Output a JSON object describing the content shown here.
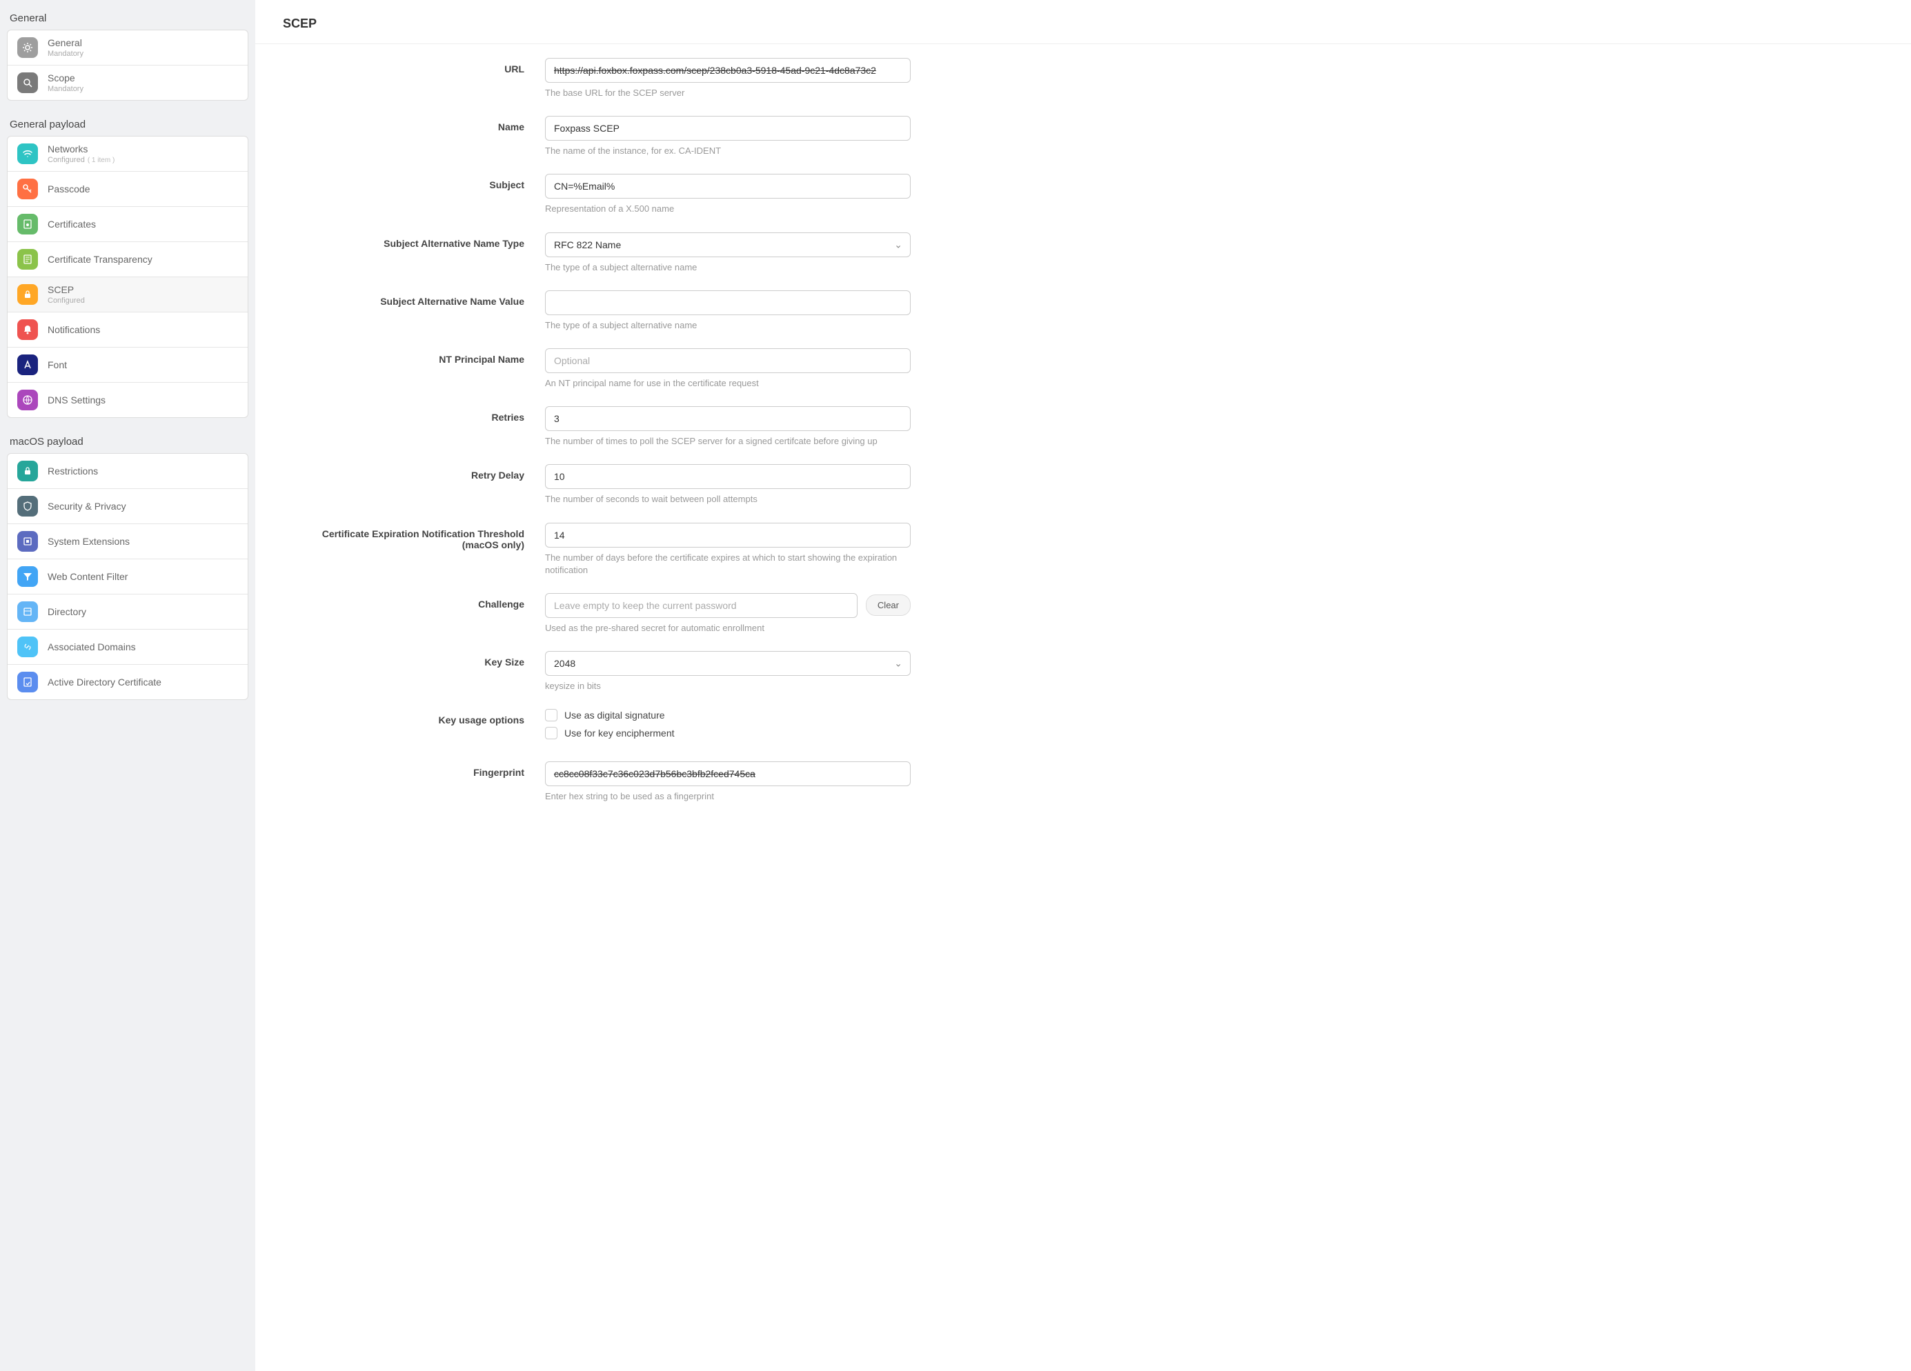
{
  "sidebar": {
    "sections": [
      {
        "title": "General",
        "items": [
          {
            "label": "General",
            "sub": "Mandatory",
            "iconBg": "bg-gray",
            "icon": "gear"
          },
          {
            "label": "Scope",
            "sub": "Mandatory",
            "iconBg": "bg-darkgray",
            "icon": "scope"
          }
        ]
      },
      {
        "title": "General payload",
        "items": [
          {
            "label": "Networks",
            "sub": "Configured",
            "count": "( 1 item )",
            "iconBg": "bg-teal",
            "icon": "wifi"
          },
          {
            "label": "Passcode",
            "iconBg": "bg-orange",
            "icon": "key"
          },
          {
            "label": "Certificates",
            "iconBg": "bg-green",
            "icon": "cert"
          },
          {
            "label": "Certificate Transparency",
            "iconBg": "bg-lightgreen",
            "icon": "doc"
          },
          {
            "label": "SCEP",
            "sub": "Configured",
            "iconBg": "bg-amber",
            "icon": "lock",
            "active": true
          },
          {
            "label": "Notifications",
            "iconBg": "bg-red",
            "icon": "bell"
          },
          {
            "label": "Font",
            "iconBg": "bg-navy",
            "icon": "font"
          },
          {
            "label": "DNS Settings",
            "iconBg": "bg-purple",
            "icon": "globe"
          }
        ]
      },
      {
        "title": "macOS payload",
        "items": [
          {
            "label": "Restrictions",
            "iconBg": "bg-emerald",
            "icon": "lock"
          },
          {
            "label": "Security & Privacy",
            "iconBg": "bg-bluegray",
            "icon": "shield"
          },
          {
            "label": "System Extensions",
            "iconBg": "bg-indigo",
            "icon": "ext"
          },
          {
            "label": "Web Content Filter",
            "iconBg": "bg-blue",
            "icon": "filter"
          },
          {
            "label": "Directory",
            "iconBg": "bg-lightblue",
            "icon": "dir"
          },
          {
            "label": "Associated Domains",
            "iconBg": "bg-skyblue",
            "icon": "link"
          },
          {
            "label": "Active Directory Certificate",
            "iconBg": "bg-medblue",
            "icon": "adcert"
          }
        ]
      }
    ]
  },
  "page": {
    "title": "SCEP"
  },
  "form": {
    "url": {
      "label": "URL",
      "value": "https://api.foxbox.foxpass.com/scep/238cb0a3-5918-45ad-9c21-4dc8a73c2",
      "help": "The base URL for the SCEP server"
    },
    "name": {
      "label": "Name",
      "value": "Foxpass SCEP",
      "help": "The name of the instance, for ex. CA-IDENT"
    },
    "subject": {
      "label": "Subject",
      "value": "CN=%Email%",
      "help": "Representation of a X.500 name"
    },
    "sanType": {
      "label": "Subject Alternative Name Type",
      "value": "RFC 822 Name",
      "help": "The type of a subject alternative name"
    },
    "sanValue": {
      "label": "Subject Alternative Name Value",
      "value": "",
      "help": "The type of a subject alternative name"
    },
    "ntPrincipal": {
      "label": "NT Principal Name",
      "value": "",
      "placeholder": "Optional",
      "help": "An NT principal name for use in the certificate request"
    },
    "retries": {
      "label": "Retries",
      "value": "3",
      "help": "The number of times to poll the SCEP server for a signed certifcate before giving up"
    },
    "retryDelay": {
      "label": "Retry Delay",
      "value": "10",
      "help": "The number of seconds to wait between poll attempts"
    },
    "certExp": {
      "label": "Certificate Expiration Notification Threshold (macOS only)",
      "value": "14",
      "help": "The number of days before the certificate expires at which to start showing the expiration notification"
    },
    "challenge": {
      "label": "Challenge",
      "value": "",
      "placeholder": "Leave empty to keep the current password",
      "help": "Used as the pre-shared secret for automatic enrollment",
      "clearLabel": "Clear"
    },
    "keySize": {
      "label": "Key Size",
      "value": "2048",
      "help": "keysize in bits"
    },
    "keyUsage": {
      "label": "Key usage options",
      "opt1": "Use as digital signature",
      "opt2": "Use for key encipherment"
    },
    "fingerprint": {
      "label": "Fingerprint",
      "value": "cc8cc08f33c7c36c023d7b56bc3bfb2fced745ca",
      "help": "Enter hex string to be used as a fingerprint"
    }
  }
}
